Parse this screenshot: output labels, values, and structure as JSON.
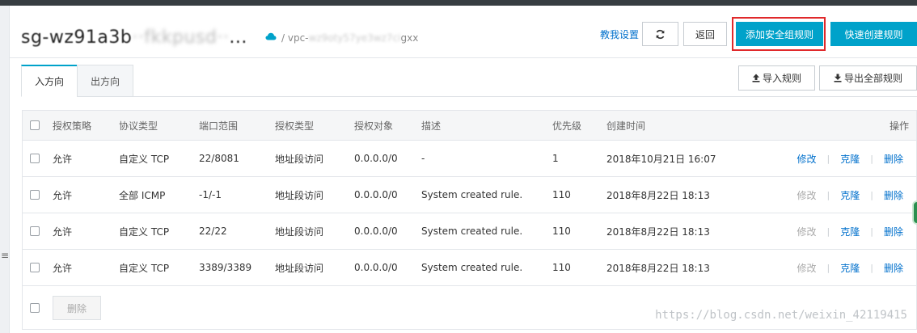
{
  "header": {
    "title_visible": "sg-wz91a3b",
    "title_obscured": "··fkkpusd··",
    "title_ellipsis": "...",
    "vpc_prefix": "/ vpc-",
    "vpc_obscured": "wz9oty57ye3wz7ci",
    "vpc_suffix": "gxx",
    "help_link": "教我设置",
    "back_button": "返回",
    "add_rule_button": "添加安全组规则",
    "quick_rule_button": "快速创建规则"
  },
  "tabs": [
    {
      "label": "入方向",
      "active": true
    },
    {
      "label": "出方向",
      "active": false
    }
  ],
  "toolbar": {
    "import_label": "导入规则",
    "export_label": "导出全部规则"
  },
  "table": {
    "headers": {
      "policy": "授权策略",
      "protocol": "协议类型",
      "port": "端口范围",
      "auth_type": "授权类型",
      "target": "授权对象",
      "description": "描述",
      "priority": "优先级",
      "created": "创建时间",
      "actions": "操作"
    },
    "rows": [
      {
        "policy": "允许",
        "protocol": "自定义 TCP",
        "port": "22/8081",
        "auth_type": "地址段访问",
        "target": "0.0.0.0/0",
        "description": "-",
        "priority": "1",
        "created": "2018年10月21日 16:07",
        "edit": "修改",
        "edit_enabled": true,
        "clone": "克隆",
        "delete": "删除"
      },
      {
        "policy": "允许",
        "protocol": "全部 ICMP",
        "port": "-1/-1",
        "auth_type": "地址段访问",
        "target": "0.0.0.0/0",
        "description": "System created rule.",
        "priority": "110",
        "created": "2018年8月22日 18:13",
        "edit": "修改",
        "edit_enabled": false,
        "clone": "克隆",
        "delete": "删除"
      },
      {
        "policy": "允许",
        "protocol": "自定义 TCP",
        "port": "22/22",
        "auth_type": "地址段访问",
        "target": "0.0.0.0/0",
        "description": "System created rule.",
        "priority": "110",
        "created": "2018年8月22日 18:13",
        "edit": "修改",
        "edit_enabled": false,
        "clone": "克隆",
        "delete": "删除"
      },
      {
        "policy": "允许",
        "protocol": "自定义 TCP",
        "port": "3389/3389",
        "auth_type": "地址段访问",
        "target": "0.0.0.0/0",
        "description": "System created rule.",
        "priority": "110",
        "created": "2018年8月22日 18:13",
        "edit": "修改",
        "edit_enabled": false,
        "clone": "克隆",
        "delete": "删除"
      }
    ],
    "batch_delete": "删除"
  },
  "watermark": "https://blog.csdn.net/weixin_42119415",
  "colors": {
    "primary": "#00a2ca",
    "link": "#0070cc",
    "highlight_outline": "#e0292b",
    "disabled": "#aaaaaa"
  },
  "icons": [
    "cloud-icon",
    "refresh-icon",
    "upload-icon",
    "download-icon",
    "menu-icon"
  ]
}
